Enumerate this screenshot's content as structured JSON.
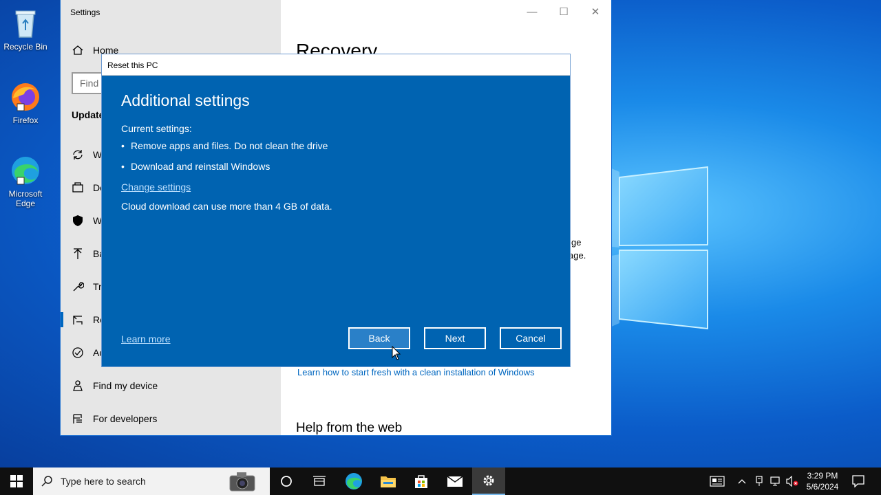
{
  "desktop": {
    "icons": [
      {
        "label": "Recycle Bin"
      },
      {
        "label": "Firefox"
      },
      {
        "label": "Microsoft Edge"
      }
    ]
  },
  "settings": {
    "title": "Settings",
    "nav": {
      "home": "Home",
      "find_placeholder": "Find",
      "section": "Update",
      "items": [
        "W",
        "De",
        "W",
        "Ba",
        "Tr",
        "Re",
        "Ac",
        "Find my device",
        "For developers"
      ]
    },
    "content": {
      "title": "Recovery",
      "frag1": "ge",
      "frag2": "age.",
      "link": "Learn how to start fresh with a clean installation of Windows",
      "help_heading": "Help from the web"
    }
  },
  "dialog": {
    "title": "Reset this PC",
    "heading": "Additional settings",
    "current_label": "Current settings:",
    "bullets": [
      "Remove apps and files. Do not clean the drive",
      "Download and reinstall Windows"
    ],
    "change_link": "Change settings",
    "note": "Cloud download can use more than 4 GB of data.",
    "learn_more": "Learn more",
    "buttons": {
      "back": "Back",
      "next": "Next",
      "cancel": "Cancel"
    }
  },
  "taskbar": {
    "search_placeholder": "Type here to search",
    "time": "3:29 PM",
    "date": "5/6/2024"
  },
  "colors": {
    "dialog_bg": "#0063b1",
    "accent": "#0067c0"
  }
}
